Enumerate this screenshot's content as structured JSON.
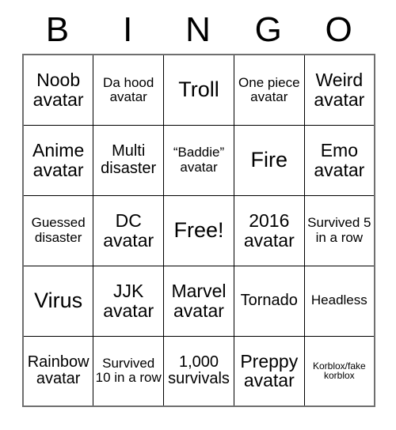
{
  "card": {
    "header_letters": [
      "B",
      "I",
      "N",
      "G",
      "O"
    ],
    "rows": [
      [
        {
          "text": "Noob avatar",
          "size": "lg"
        },
        {
          "text": "Da hood avatar",
          "size": "sm"
        },
        {
          "text": "Troll",
          "size": "xl"
        },
        {
          "text": "One piece avatar",
          "size": "sm"
        },
        {
          "text": "Weird avatar",
          "size": "lg"
        }
      ],
      [
        {
          "text": "Anime avatar",
          "size": "lg"
        },
        {
          "text": "Multi disaster",
          "size": "md"
        },
        {
          "text": "“Baddie” avatar",
          "size": "sm"
        },
        {
          "text": "Fire",
          "size": "xl"
        },
        {
          "text": "Emo avatar",
          "size": "lg"
        }
      ],
      [
        {
          "text": "Guessed disaster",
          "size": "sm"
        },
        {
          "text": "DC avatar",
          "size": "lg"
        },
        {
          "text": "Free!",
          "size": "xl"
        },
        {
          "text": "2016 avatar",
          "size": "lg"
        },
        {
          "text": "Survived 5 in a row",
          "size": "sm"
        }
      ],
      [
        {
          "text": "Virus",
          "size": "xl"
        },
        {
          "text": "JJK avatar",
          "size": "lg"
        },
        {
          "text": "Marvel avatar",
          "size": "lg"
        },
        {
          "text": "Tornado",
          "size": "md"
        },
        {
          "text": "Headless",
          "size": "sm"
        }
      ],
      [
        {
          "text": "Rainbow avatar",
          "size": "md"
        },
        {
          "text": "Survived 10 in a row",
          "size": "sm"
        },
        {
          "text": "1,000 survivals",
          "size": "md"
        },
        {
          "text": "Preppy avatar",
          "size": "lg"
        },
        {
          "text": "Korblox/fake korblox",
          "size": "xxs"
        }
      ]
    ],
    "colors": {
      "background": "#ffffff",
      "text": "#000000",
      "grid_line": "#000000",
      "outer_border": "#6f6f6f"
    }
  }
}
